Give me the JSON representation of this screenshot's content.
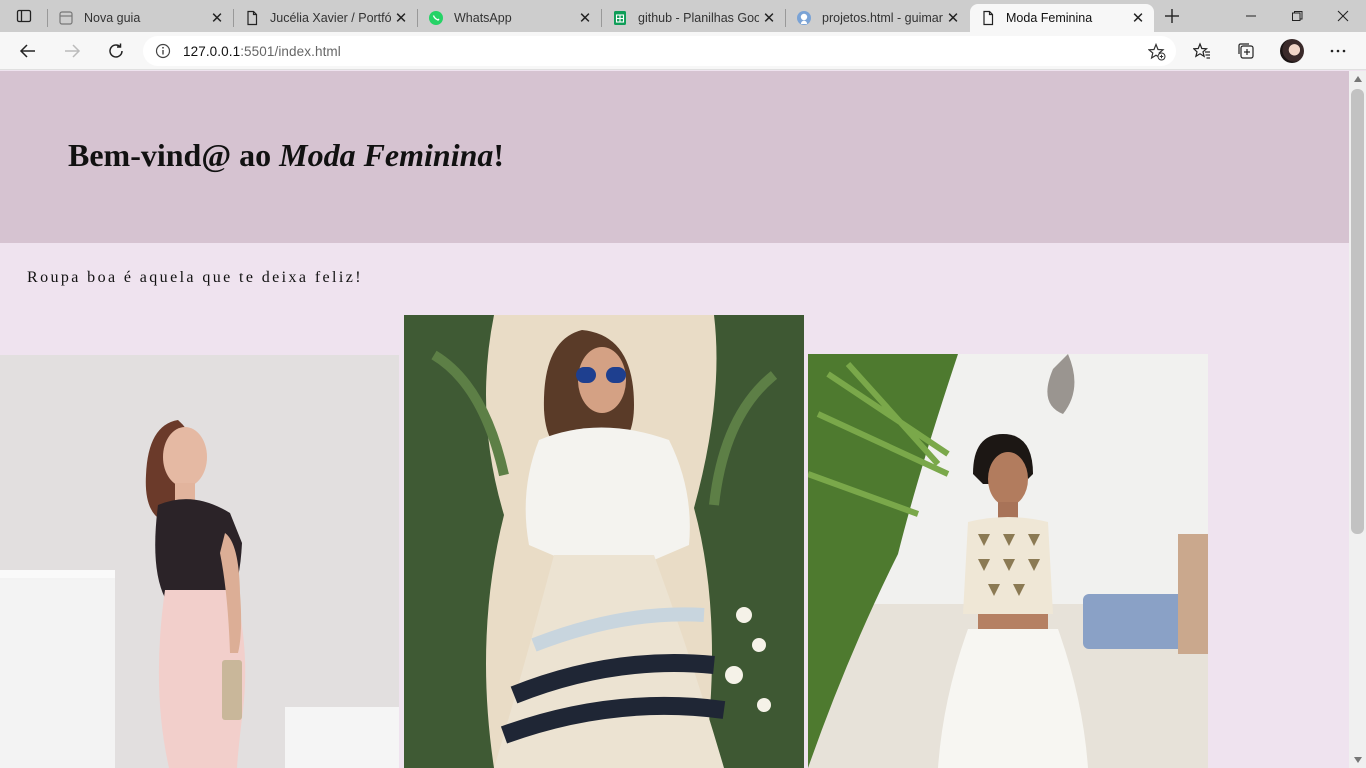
{
  "browser": {
    "tabs": [
      {
        "title": "Nova guia",
        "icon": "new-tab-page-icon"
      },
      {
        "title": "Jucélia Xavier / Portfólio",
        "icon": "document-icon"
      },
      {
        "title": "WhatsApp",
        "icon": "whatsapp-icon"
      },
      {
        "title": "github - Planilhas Google",
        "icon": "google-sheets-icon"
      },
      {
        "title": "projetos.html - guimaraes",
        "icon": "github-icon"
      },
      {
        "title": "Moda Feminina",
        "icon": "document-icon",
        "active": true
      }
    ],
    "url_host": "127.0.0.1",
    "url_rest": ":5501/index.html",
    "colors": {
      "tabstrip": "#cdcdcd",
      "toolbar": "#f7f7f7"
    }
  },
  "page": {
    "heading_prefix": "Bem-vind@ ao ",
    "heading_emphasis": "Moda Feminina",
    "heading_suffix": "!",
    "tagline": "Roupa boa é aquela que te deixa feliz!",
    "images": [
      {
        "subject": "woman in black lace top and pink skirt"
      },
      {
        "subject": "woman in white shirt, sunglasses and striped ruffle skirt among plants"
      },
      {
        "subject": "woman in embellished crop top and white skirt outdoors"
      }
    ],
    "colors": {
      "header_band": "#d6c3d1",
      "page_background": "#efe3ef"
    }
  }
}
